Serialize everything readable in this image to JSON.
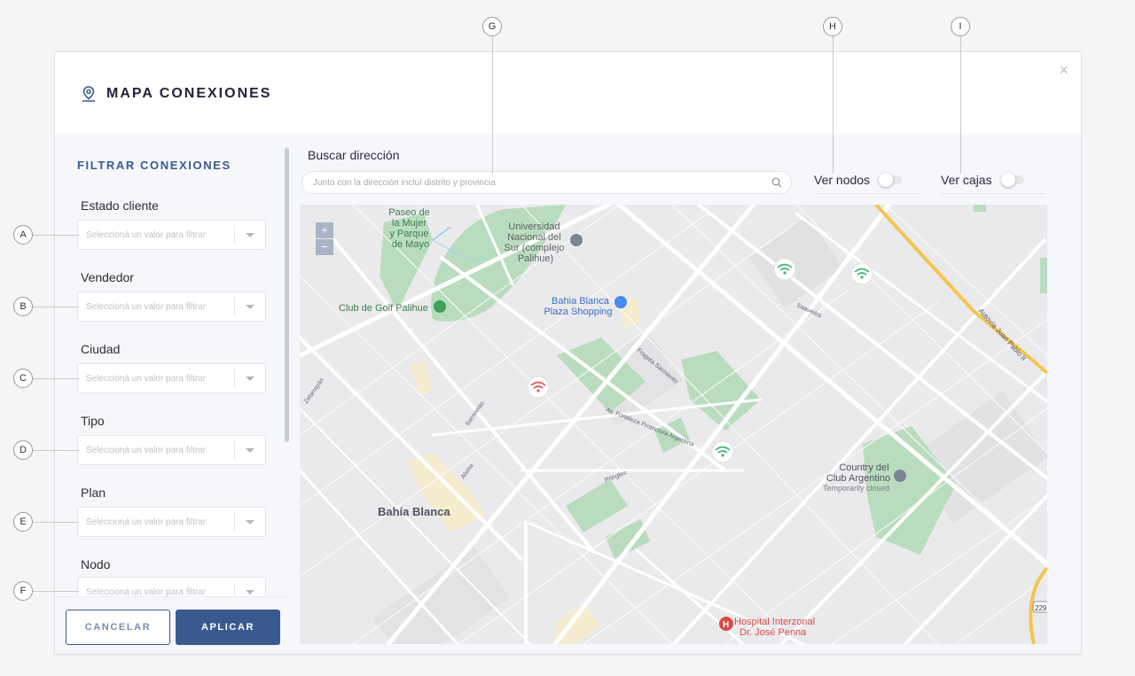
{
  "callouts": [
    "A",
    "B",
    "C",
    "D",
    "E",
    "F",
    "G",
    "H",
    "I"
  ],
  "modal": {
    "title": "MAPA CONEXIONES",
    "close_symbol": "×",
    "icon": "map-pin-icon"
  },
  "filters": {
    "heading": "FILTRAR CONEXIONES",
    "items": [
      {
        "label": "Estado cliente",
        "placeholder": "Seleccioná un valor para filtrar"
      },
      {
        "label": "Vendedor",
        "placeholder": "Seleccioná un valor para filtrar"
      },
      {
        "label": "Ciudad",
        "placeholder": "Seleccioná un valor para filtrar"
      },
      {
        "label": "Tipo",
        "placeholder": "Seleccioná un valor para filtrar"
      },
      {
        "label": "Plan",
        "placeholder": "Seleccioná un valor para filtrar"
      },
      {
        "label": "Nodo",
        "placeholder": "Seleccioná un valor para filtrar"
      }
    ]
  },
  "buttons": {
    "cancel": "CANCELAR",
    "apply": "APLICAR"
  },
  "search": {
    "label": "Buscar dirección",
    "placeholder": "Junto con la dirección incluí distrito y provincia"
  },
  "toggles": {
    "nodes_label": "Ver nodos",
    "boxes_label": "Ver cajas"
  },
  "map": {
    "zoom_in": "+",
    "zoom_out": "−",
    "labels": {
      "park": "Paseo de la Mujer y Parque de Mayo",
      "university": "Universidad Nacional del Sur (complejo Palihue)",
      "golf": "Club de Golf Palihue",
      "shopping": "Bahía Blanca Plaza Shopping",
      "city": "Bahía Blanca",
      "country_club": "Country del Club Argentino",
      "temporarily_closed": "Temporarily closed",
      "hospital": "Hospital Interzonal Dr. José Penna",
      "highway": "Autovía Juan Pablo II",
      "route_shield": "229"
    },
    "street_labels": [
      "Pringles",
      "Av. Fortaleza Protectora Argentina",
      "Fragata Sarmiento",
      "Sarmiento",
      "Alsina",
      "Zelarrayán",
      "Saavedra"
    ],
    "colors": {
      "park": "#b9dcbf",
      "highway": "#f3c44f",
      "node_marker": "#3cb878",
      "alert_marker": "#e05555"
    }
  }
}
